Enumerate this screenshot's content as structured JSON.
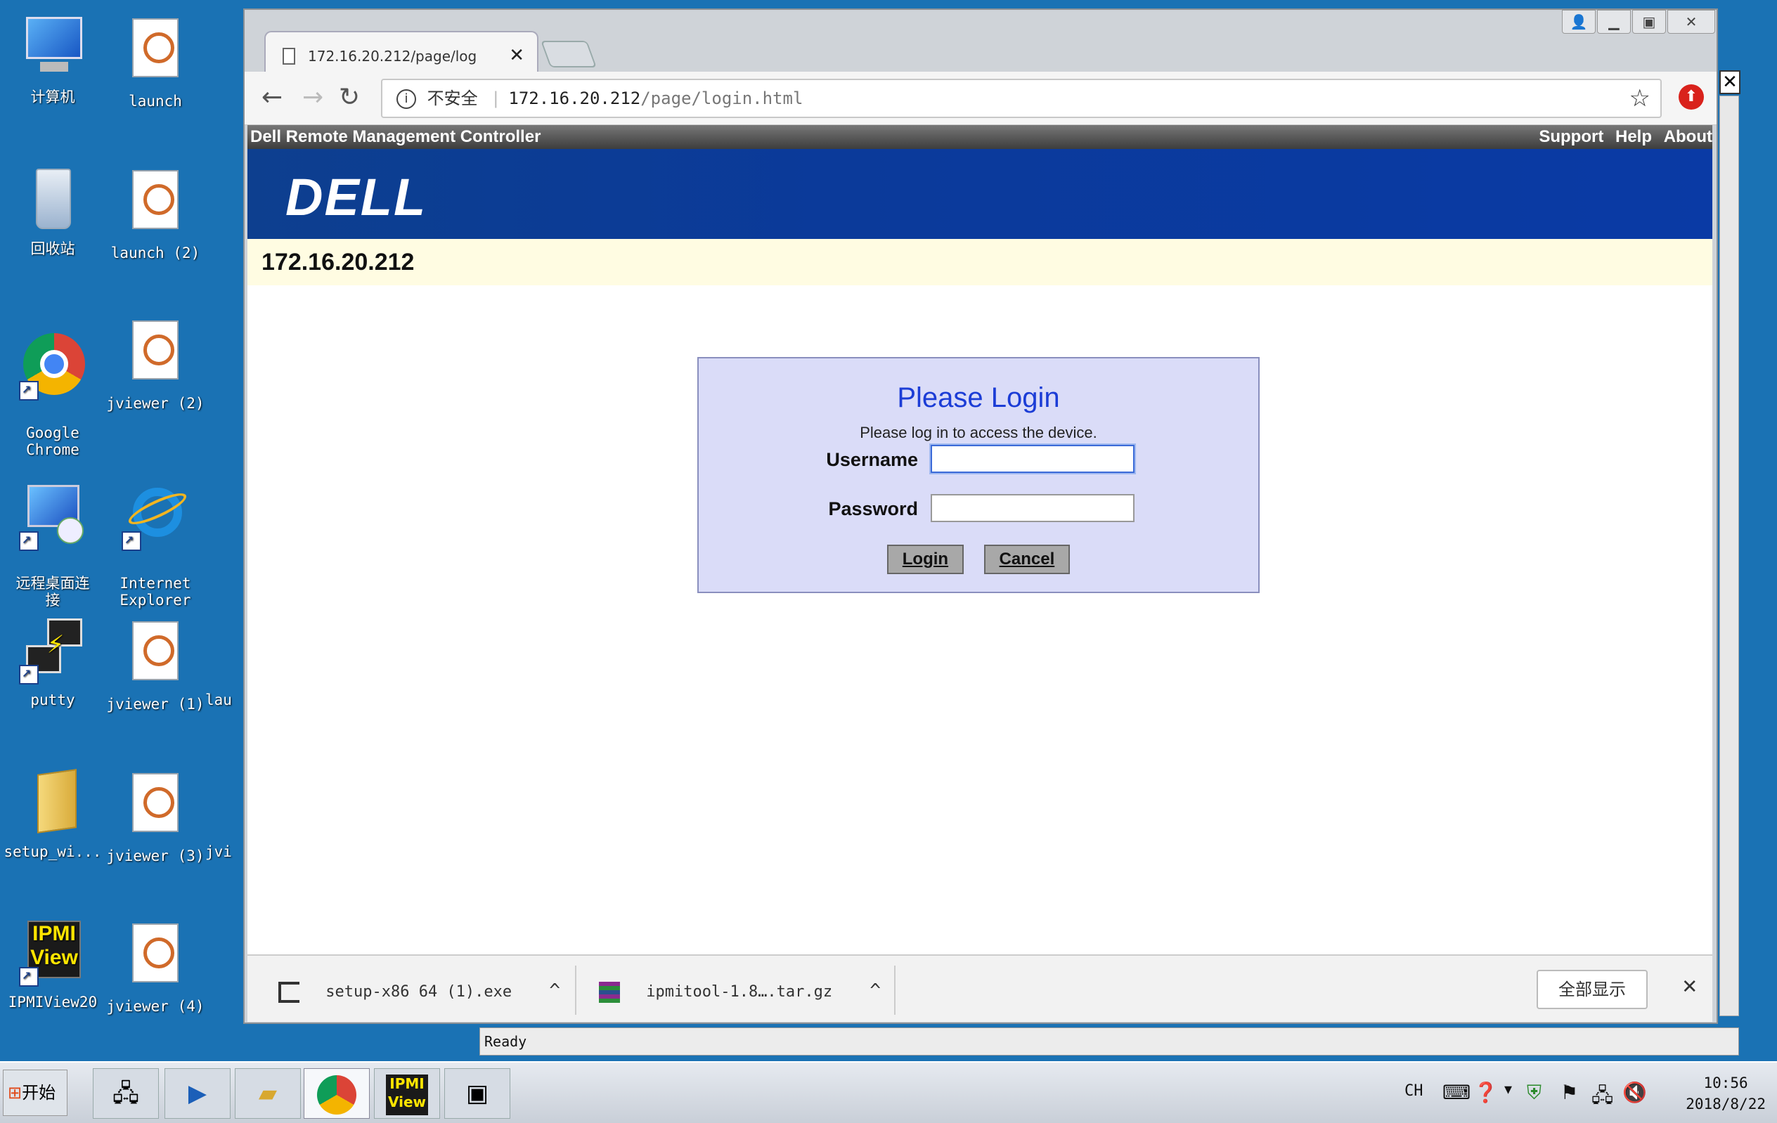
{
  "desktop": {
    "icons": [
      {
        "label": "计算机",
        "icon": "computer-icon"
      },
      {
        "label": "launch",
        "icon": "java-file-icon"
      },
      {
        "label": "回收站",
        "icon": "recycle-bin-icon"
      },
      {
        "label": "launch (2)",
        "icon": "java-file-icon"
      },
      {
        "label": "Google\nChrome",
        "icon": "chrome-icon"
      },
      {
        "label": "jviewer (2)",
        "icon": "java-file-icon"
      },
      {
        "label": "远程桌面连\n接",
        "icon": "remote-desktop-icon"
      },
      {
        "label": "Internet\nExplorer",
        "icon": "ie-icon"
      },
      {
        "label": "putty",
        "icon": "putty-icon"
      },
      {
        "label": "jviewer (1)",
        "icon": "java-file-icon"
      },
      {
        "label": "lau",
        "icon": "java-file-icon"
      },
      {
        "label": "setup_wi...",
        "icon": "folder-icon"
      },
      {
        "label": "jviewer (3)",
        "icon": "java-file-icon"
      },
      {
        "label": "jvi",
        "icon": "java-file-icon"
      },
      {
        "label": "IPMIView20",
        "icon": "ipmiview-icon"
      },
      {
        "label": "jviewer (4)",
        "icon": "java-file-icon"
      }
    ]
  },
  "browser": {
    "tab_title": "172.16.20.212/page/log",
    "address": {
      "security_label": "不安全",
      "host": "172.16.20.212",
      "path": "/page/login.html"
    }
  },
  "drac": {
    "product_title": "Dell Remote Management Controller",
    "links": [
      "Support",
      "Help",
      "About"
    ],
    "logo_text": "DELL",
    "ip": "172.16.20.212"
  },
  "login": {
    "title": "Please Login",
    "subtitle": "Please log in to access the device.",
    "username_label": "Username",
    "password_label": "Password",
    "username_value": "",
    "password_value": "",
    "login_button": "Login",
    "cancel_button": "Cancel"
  },
  "downloads": {
    "items": [
      {
        "name": "setup-x86 64 (1).exe"
      },
      {
        "name": "ipmitool-1.8….tar.gz"
      }
    ],
    "show_all": "全部显示"
  },
  "statusbar": {
    "text": "Ready"
  },
  "taskbar": {
    "start_label": "开始",
    "lang": "CH",
    "time": "10:56",
    "date": "2018/8/22"
  },
  "colors": {
    "desktop_bg": "#1a72b4",
    "dell_blue": "#0b3a9a",
    "login_box_bg": "#dadcf8",
    "login_title": "#1c3dd6"
  }
}
